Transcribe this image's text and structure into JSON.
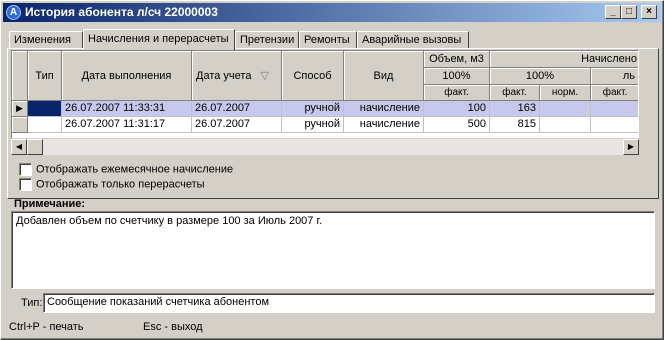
{
  "window": {
    "title": "История абонента л/сч 22000003",
    "min_glyph": "_",
    "max_glyph": "□",
    "close_glyph": "×"
  },
  "tabs": [
    {
      "label": "Изменения"
    },
    {
      "label": "Начисления и перерасчеты",
      "active": true
    },
    {
      "label": "Претензии"
    },
    {
      "label": "Ремонты"
    },
    {
      "label": "Аварийные вызовы"
    }
  ],
  "grid": {
    "headers": {
      "tip": "Тип",
      "data_vypolneniya": "Дата выполнения",
      "data_ucheta": "Дата учета",
      "sort_icon": "▽",
      "sposob": "Способ",
      "vid": "Вид",
      "obem": "Объем, м3",
      "obem_pct": "100%",
      "obem_fakt": "факт.",
      "nachisleno": "Начислено",
      "nach_pct": "100%",
      "nach_fakt": "факт.",
      "nach_norm": "норм.",
      "lg": "ль",
      "lg_fakt": "факт."
    },
    "rows": [
      {
        "indicator": "▶",
        "tip": "",
        "data_vypolneniya": "26.07.2007 11:33:31",
        "data_ucheta": "26.07.2007",
        "sposob": "ручной",
        "vid": "начисление",
        "obem_fakt": "100",
        "nach_fakt": "163",
        "nach_norm": "",
        "lg_fakt": ""
      },
      {
        "indicator": "",
        "tip": "",
        "data_vypolneniya": "26.07.2007 11:31:17",
        "data_ucheta": "26.07.2007",
        "sposob": "ручной",
        "vid": "начисление",
        "obem_fakt": "500",
        "nach_fakt": "815",
        "nach_norm": "",
        "lg_fakt": ""
      }
    ],
    "scroll_left": "◀",
    "scroll_right": "▶"
  },
  "options": {
    "monthly": "Отображать ежемесячное начисление",
    "recalc_only": "Отображать только перерасчеты"
  },
  "note": {
    "label": "Примечание:",
    "text": "Добавлен объем по счетчику в размере 100 за Июль 2007 г."
  },
  "type": {
    "label": "Тип:",
    "value": "Сообщение показаний счетчика абонентом"
  },
  "status": {
    "print": "Ctrl+P -  печать",
    "exit": "Esc - выход"
  }
}
